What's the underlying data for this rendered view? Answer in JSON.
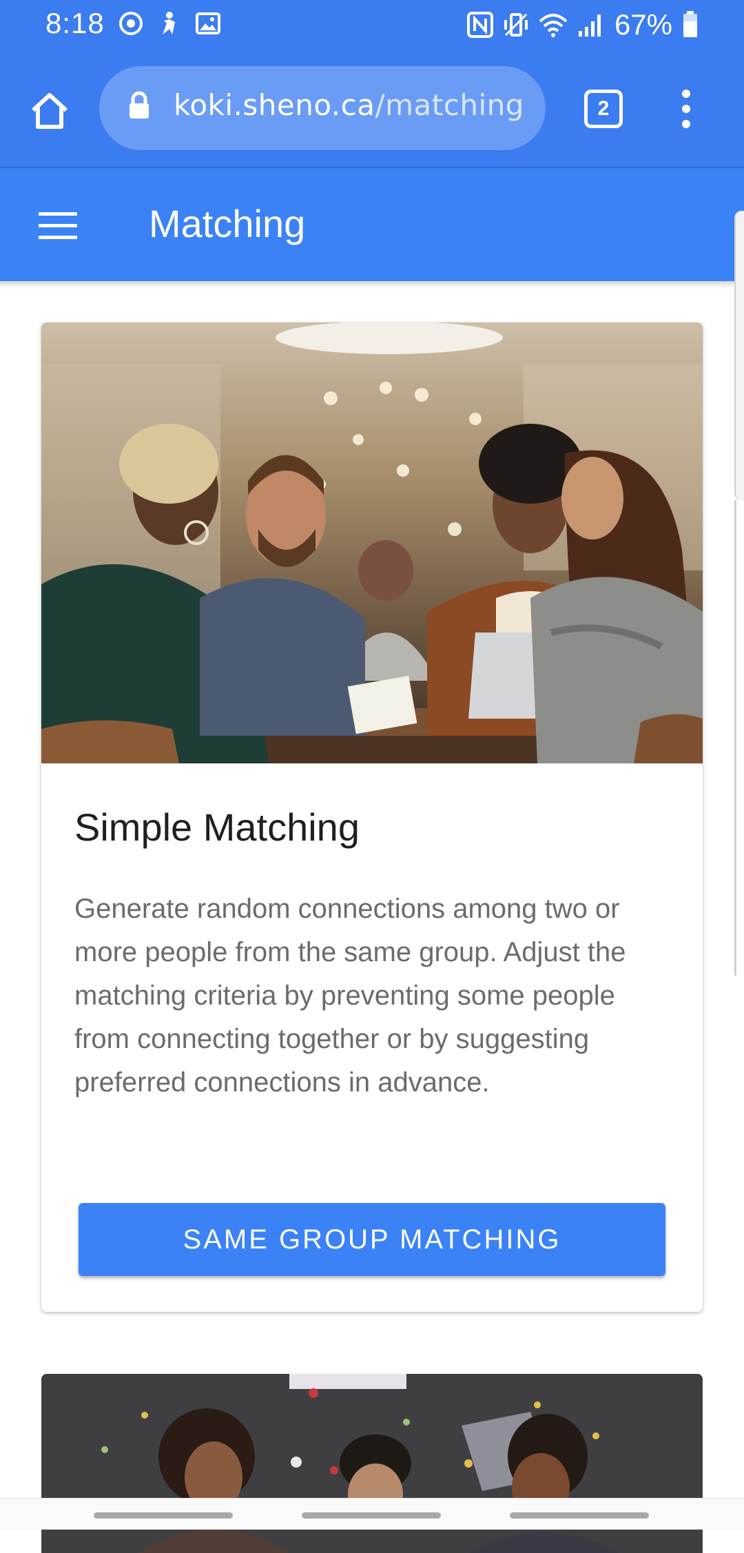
{
  "status_bar": {
    "time": "8:18",
    "battery": "67%",
    "left_icons": [
      "media-icon",
      "accessibility-icon",
      "gallery-icon"
    ],
    "right_icons": [
      "nfc-icon",
      "vibrate-icon",
      "wifi-icon",
      "signal-icon",
      "battery-icon"
    ]
  },
  "browser": {
    "url_host": "koki.sheno.ca",
    "url_path": "/matching",
    "tab_count": "2"
  },
  "app_bar": {
    "title": "Matching"
  },
  "cards": [
    {
      "title": "Simple Matching",
      "description": "Generate random connections among two or more people from the same group. Adjust the matching criteria by preventing some people from connecting together or by suggesting preferred connections in advance.",
      "button_label": "SAME GROUP MATCHING"
    }
  ],
  "colors": {
    "primary": "#3b82f6",
    "browser_bar": "#3b7cf0",
    "title_text": "#1f1f1f",
    "body_text": "#6b6b6b"
  }
}
